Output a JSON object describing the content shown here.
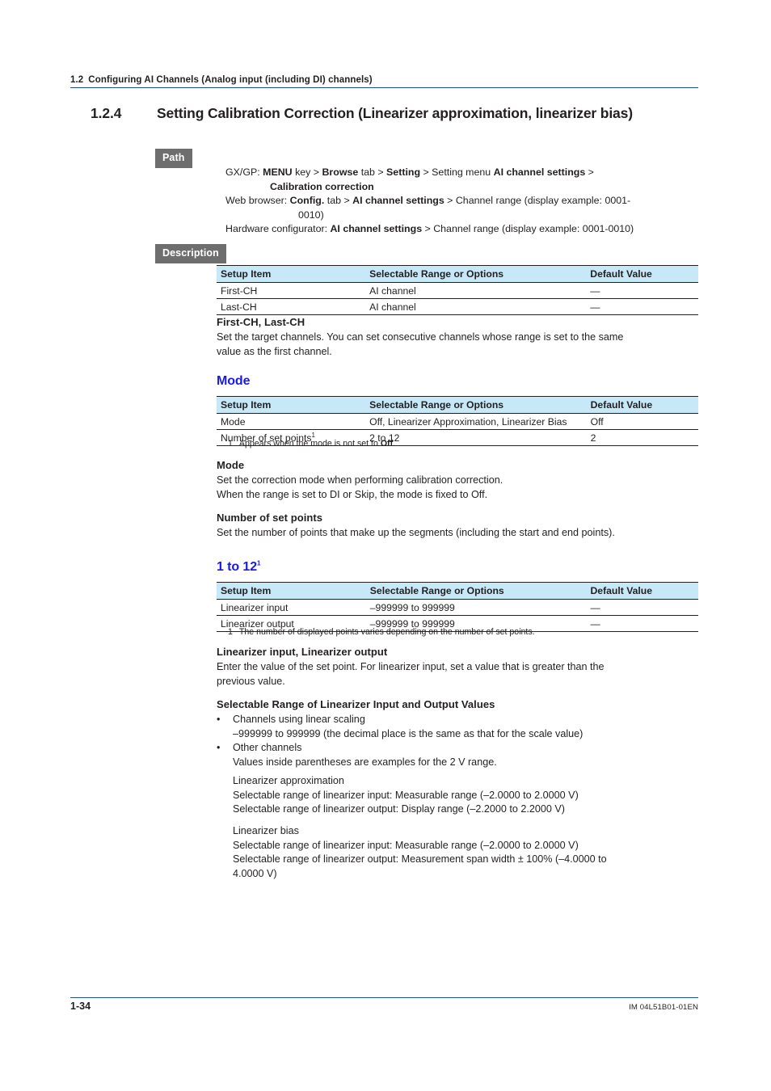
{
  "running_header": {
    "section_number": "1.2",
    "title": "Configuring AI Channels (Analog input (including DI) channels)",
    "rule_color": "#1f4e9c"
  },
  "section": {
    "number": "1.2.4",
    "title": "Setting Calibration Correction (Linearizer approximation, linearizer bias)"
  },
  "badges": {
    "path": "Path",
    "description": "Description",
    "background": "#6e6e6e",
    "text_color": "#ffffff"
  },
  "path": {
    "line1_pre": "GX/GP: ",
    "line1_b1": "MENU",
    "line1_m1": " key > ",
    "line1_b2": "Browse",
    "line1_m2": " tab > ",
    "line1_b3": "Setting",
    "line1_m3": " > Setting menu ",
    "line1_b4": "AI channel settings",
    "line1_m4": " >",
    "line1_cont": "Calibration correction",
    "line2_pre": "Web browser: ",
    "line2_b1": "Config.",
    "line2_m1": " tab > ",
    "line2_b2": "AI channel settings",
    "line2_m2": " > Channel range (display example: 0001-",
    "line2_cont": "0010)",
    "line3_pre": "Hardware configurator: ",
    "line3_b1": "AI channel settings",
    "line3_m1": " > Channel range (display example: 0001-0010)"
  },
  "table_common": {
    "headers": [
      "Setup Item",
      "Selectable Range or Options",
      "Default Value"
    ],
    "header_bg": "#c7e9f7"
  },
  "table1": {
    "rows": [
      {
        "item": "First-CH",
        "range": "AI channel",
        "default": "—"
      },
      {
        "item": "Last-CH",
        "range": "AI channel",
        "default": "—"
      }
    ]
  },
  "first_last_ch": {
    "heading": "First-CH, Last-CH",
    "body_line1": "Set the target channels. You can set consecutive channels whose range is set to the same",
    "body_line2": "value as the first channel."
  },
  "mode_section": {
    "heading": "Mode",
    "heading_color": "#1a1ae6",
    "table": {
      "rows": [
        {
          "item": "Mode",
          "item_sup": "",
          "range": "Off, Linearizer Approximation, Linearizer Bias",
          "default": "Off"
        },
        {
          "item": "Number of set points",
          "item_sup": "1",
          "range": "2 to 12",
          "default": "2"
        }
      ]
    },
    "footnote_num": "1",
    "footnote_pre": "Appears when the mode is not set to ",
    "footnote_b": "Off",
    "footnote_post": ".",
    "sub_mode_heading": "Mode",
    "sub_mode_line1": "Set the correction mode when performing calibration correction.",
    "sub_mode_line2": "When the range is set to DI or Skip, the mode is fixed to Off.",
    "sub_points_heading": "Number of set points",
    "sub_points_line1": "Set the number of points that make up the segments (including the start and end points)."
  },
  "one_to_twelve_section": {
    "heading": "1 to 12",
    "heading_sup": "1",
    "heading_color": "#1a1ae6",
    "table": {
      "rows": [
        {
          "item": "Linearizer input",
          "range": "–999999 to 999999",
          "default": "—"
        },
        {
          "item": "Linearizer output",
          "range": "–999999 to 999999",
          "default": "—"
        }
      ]
    },
    "footnote_num": "1",
    "footnote_text": "The number of displayed points varies depending on the number of set points."
  },
  "linearizer_io": {
    "heading": "Linearizer input, Linearizer output",
    "line1": "Enter the value of the set point. For linearizer input, set a value that is greater than the",
    "line2": "previous value."
  },
  "selectable_range": {
    "heading": "Selectable Range of Linearizer Input and Output Values",
    "bullet_char": "•",
    "bullets": [
      {
        "title": "Channels using linear scaling",
        "detail": "–999999 to 999999 (the decimal place is the same as that for the scale value)"
      },
      {
        "title": "Other channels",
        "detail": "Values inside parentheses are examples for the 2 V range."
      }
    ]
  },
  "linearizer_approximation": {
    "title": "Linearizer approximation",
    "line1": "Selectable range of linearizer input: Measurable range (–2.0000 to 2.0000 V)",
    "line2": "Selectable range of linearizer output: Display range (–2.2000 to 2.2000 V)"
  },
  "linearizer_bias": {
    "title": "Linearizer bias",
    "line1": "Selectable range of linearizer input: Measurable range (–2.0000 to 2.0000 V)",
    "line2": "Selectable range of linearizer output: Measurement span width ± 100% (–4.0000 to",
    "line3": "4.0000 V)"
  },
  "footer": {
    "page_number": "1-34",
    "document_code": "IM 04L51B01-01EN",
    "rule_color": "#1f4e9c"
  }
}
